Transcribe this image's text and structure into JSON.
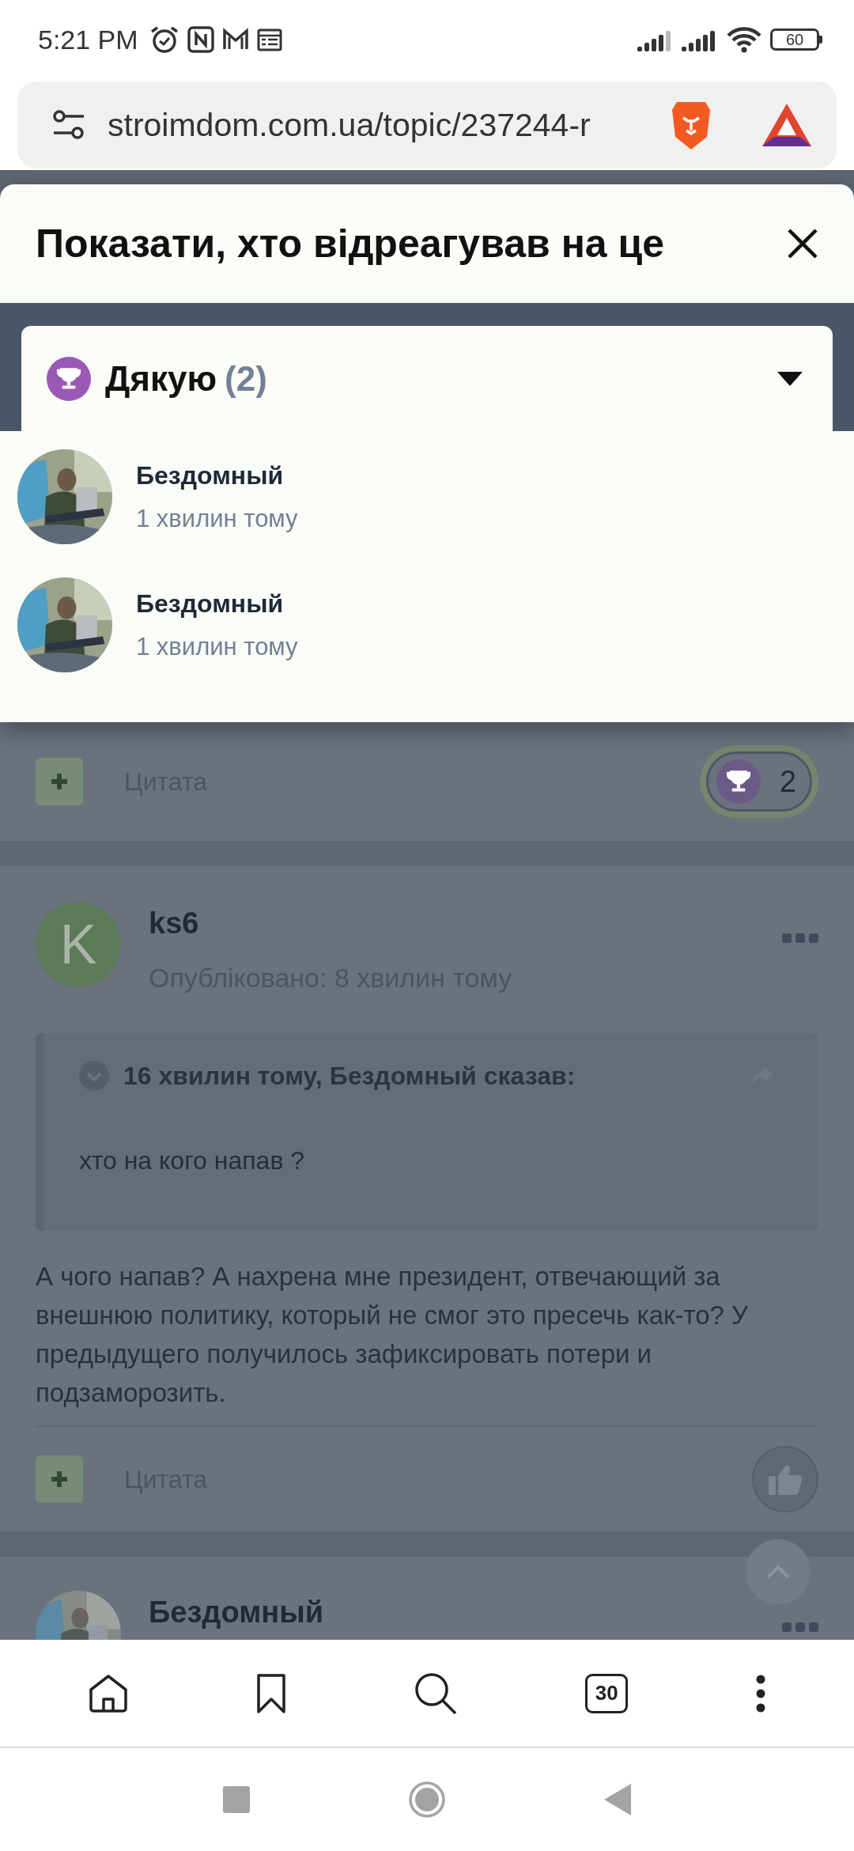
{
  "status_bar": {
    "time": "5:21 PM",
    "battery": "60"
  },
  "address_bar": {
    "url": "stroimdom.com.ua/topic/237244-r"
  },
  "reactions_sheet": {
    "title": "Показати, хто відреагував на це",
    "reaction": {
      "label": "Дякую",
      "count": "(2)"
    },
    "users": [
      {
        "name": "Бездомный",
        "time": "1 хвилин тому"
      },
      {
        "name": "Бездомный",
        "time": "1 хвилин тому"
      }
    ]
  },
  "previous_post_footer": {
    "quote_label": "Цитата",
    "reaction_count": "2"
  },
  "posts": [
    {
      "author": "ks6",
      "avatar_letter": "K",
      "meta": "Опубліковано: 8 хвилин тому",
      "quote": {
        "header": "16 хвилин тому, Бездомный сказав:",
        "text": "хто на кого напав ?"
      },
      "body": "А чого напав? А нахрена мне президент, отвечающий за внешнюю политику, который не смог это пресечь как-то? У предыдущего получилось зафиксировать потери и подзаморозить.",
      "quote_label": "Цитата"
    },
    {
      "author": "Бездомный"
    }
  ],
  "browser_toolbar": {
    "tab_count": "30"
  }
}
